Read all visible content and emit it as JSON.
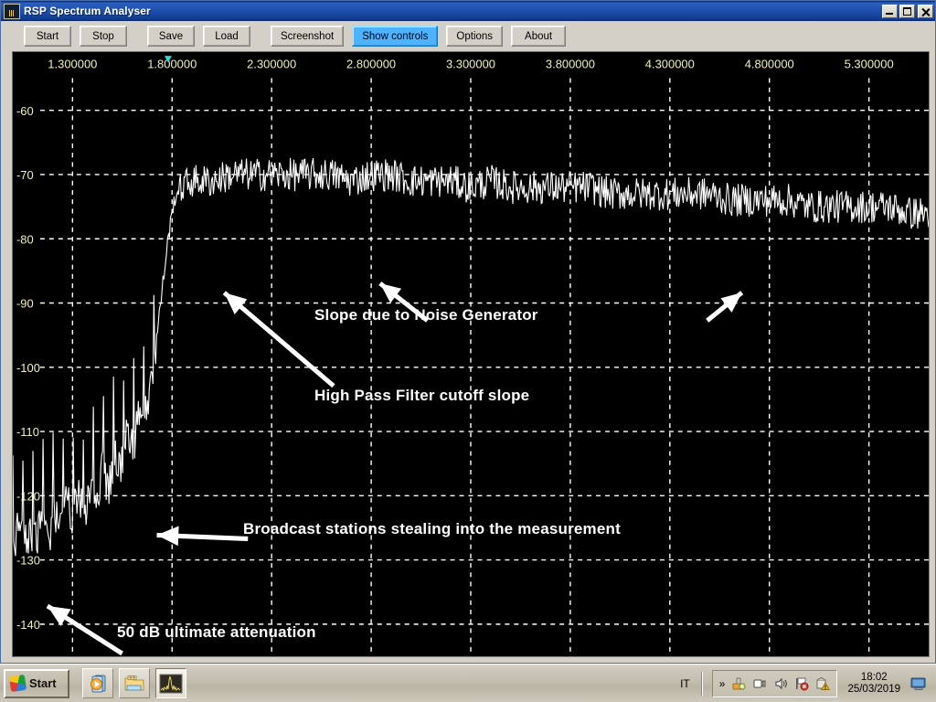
{
  "window": {
    "title": "RSP Spectrum Analyser",
    "icon": "spectrum-icon",
    "minimize_label": "Minimize",
    "maximize_label": "Maximize",
    "close_label": "Close"
  },
  "toolbar": {
    "buttons": [
      {
        "label": "Start",
        "active": false
      },
      {
        "label": "Stop",
        "active": false
      },
      {
        "label": "Save",
        "active": false
      },
      {
        "label": "Load",
        "active": false
      },
      {
        "label": "Screenshot",
        "active": false
      },
      {
        "label": "Show controls",
        "active": true
      },
      {
        "label": "Options",
        "active": false
      },
      {
        "label": "About",
        "active": false
      }
    ]
  },
  "annotations": [
    {
      "id": "slope-noise-generator",
      "text": "Slope due to Noise Generator"
    },
    {
      "id": "hpf-cutoff-slope",
      "text": "High Pass Filter cutoff slope"
    },
    {
      "id": "broadcast-stations",
      "text": "Broadcast stations stealing into the measurement"
    },
    {
      "id": "ultimate-attenuation",
      "text": "50 dB ultimate attenuation"
    }
  ],
  "taskbar": {
    "start_label": "Start",
    "tasks": [
      {
        "name": "media-player-task",
        "selected": false
      },
      {
        "name": "file-explorer-task",
        "selected": false
      },
      {
        "name": "spectrum-analyser-task",
        "selected": true
      }
    ],
    "tray": {
      "language": "IT",
      "expand_label": "»",
      "icons": [
        "safely-remove-hardware-icon",
        "network-connection-icon",
        "volume-icon",
        "flag-alert-icon",
        "security-warning-icon",
        "display-icon"
      ],
      "time": "18:02",
      "date": "25/03/2019"
    }
  },
  "chart_data": {
    "type": "line",
    "title": "",
    "xlabel": "",
    "ylabel": "",
    "xtick_labels": [
      "1.300000",
      "1.800000",
      "2.300000",
      "2.800000",
      "3.300000",
      "3.800000",
      "4.300000",
      "4.800000",
      "5.300000"
    ],
    "xtick_values": [
      1.3,
      1.8,
      2.3,
      2.8,
      3.3,
      3.8,
      4.3,
      4.8,
      5.3
    ],
    "xlim": [
      1.0,
      5.6
    ],
    "ytick_labels": [
      "-60",
      "-70",
      "-80",
      "-90",
      "-100",
      "-110",
      "-120",
      "-130",
      "-140"
    ],
    "ytick_values": [
      -60,
      -70,
      -80,
      -90,
      -100,
      -110,
      -120,
      -130,
      -140
    ],
    "ylim": [
      -145,
      -55
    ],
    "grid": true,
    "legend": false,
    "trace_color": "#ffffff",
    "grid_color": "#ffffff",
    "background": "#000000",
    "label_color": "#f2f0b4",
    "marker": {
      "name": "center-frequency-marker",
      "x": 1.78,
      "color": "#26e0d8"
    },
    "series": [
      {
        "name": "spectrum",
        "description": "Swept spectrum trace: stopband comb of broadcast carriers near -125 dB rising through the high-pass filter cutoff slope to a noise-generator plateau near -72 dB with gentle downward slope toward 5.6 MHz",
        "x": [
          1.0,
          1.03,
          1.06,
          1.09,
          1.12,
          1.15,
          1.18,
          1.21,
          1.24,
          1.27,
          1.3,
          1.33,
          1.36,
          1.39,
          1.42,
          1.45,
          1.48,
          1.51,
          1.54,
          1.57,
          1.6,
          1.63,
          1.66,
          1.69,
          1.72,
          1.75,
          1.78,
          1.81,
          1.84,
          1.9,
          2.0,
          2.1,
          2.2,
          2.3,
          2.4,
          2.5,
          2.6,
          2.7,
          2.8,
          2.9,
          3.0,
          3.1,
          3.2,
          3.3,
          3.4,
          3.5,
          3.6,
          3.7,
          3.8,
          3.9,
          4.0,
          4.1,
          4.2,
          4.3,
          4.4,
          4.5,
          4.6,
          4.7,
          4.8,
          4.9,
          5.0,
          5.1,
          5.2,
          5.3,
          5.4,
          5.5,
          5.6
        ],
        "y": [
          -124,
          -122,
          -125,
          -121,
          -124,
          -120,
          -123,
          -119,
          -122,
          -118,
          -120,
          -117,
          -119,
          -115,
          -117,
          -113,
          -115,
          -111,
          -112,
          -108,
          -109,
          -105,
          -104,
          -100,
          -96,
          -88,
          -80,
          -74,
          -72,
          -71,
          -71,
          -70,
          -70,
          -70,
          -70,
          -70,
          -70,
          -71,
          -70,
          -70,
          -71,
          -71,
          -71,
          -72,
          -71,
          -72,
          -72,
          -72,
          -72,
          -72,
          -73,
          -73,
          -73,
          -73,
          -73,
          -73,
          -74,
          -74,
          -74,
          -74,
          -75,
          -75,
          -75,
          -75,
          -75,
          -76,
          -76
        ]
      }
    ]
  }
}
